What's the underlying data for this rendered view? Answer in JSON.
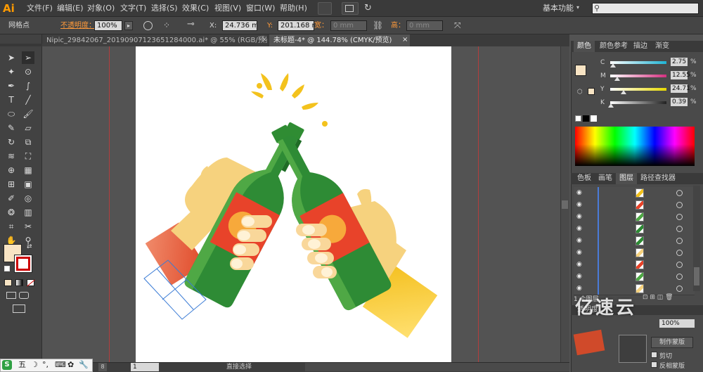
{
  "app": {
    "logo": "Ai",
    "menus": [
      "文件(F)",
      "编辑(E)",
      "对象(O)",
      "文字(T)",
      "选择(S)",
      "效果(C)",
      "视图(V)",
      "窗口(W)",
      "帮助(H)"
    ],
    "workspace": "基本功能"
  },
  "control": {
    "selection_label": "网格点",
    "opacity_label": "不透明度：",
    "opacity_value": "100%",
    "x_label": "X:",
    "x_value": "24.736 m",
    "y_label": "Y:",
    "y_value": "201.168 m",
    "w_label": "宽：",
    "w_value": "0 mm",
    "h_label": "高：",
    "h_value": "0 mm"
  },
  "tabs": [
    {
      "label": "Nipic_29842067_20190907123651284000.ai* @ 55% (RGB/预览)",
      "active": false
    },
    {
      "label": "未标题-4* @ 144.78% (CMYK/预览)",
      "active": true
    }
  ],
  "color_panel": {
    "tabs": [
      "颜色",
      "颜色参考",
      "描边",
      "渐变"
    ],
    "channels": [
      {
        "name": "C",
        "value": "2.75",
        "pct": 0.0275,
        "color": "#1fb3d3"
      },
      {
        "name": "M",
        "value": "12.55",
        "pct": 0.1255,
        "color": "#d4307f"
      },
      {
        "name": "Y",
        "value": "24.71",
        "pct": 0.2471,
        "color": "#e6d800"
      },
      {
        "name": "K",
        "value": "0.39",
        "pct": 0.0039,
        "color": "#222222"
      }
    ],
    "unit": "%",
    "fill_color": "#f8e4c4"
  },
  "layers_panel": {
    "tabs": [
      "色板",
      "画笔",
      "图层",
      "路径查找器"
    ],
    "row_count": 9,
    "footer": "1 个图层"
  },
  "lower_panel": {
    "tab": "透明度",
    "opacity": "100%",
    "make_mask": "制作蒙版",
    "clip": "剪切",
    "invert": "反相蒙版"
  },
  "status": {
    "page": "1",
    "tool": "直接选择",
    "zoom": "8"
  },
  "ime": {
    "items": [
      "五",
      "☽",
      "°,",
      "⌨",
      "✿",
      "🔧"
    ]
  },
  "watermark": {
    "text": "亿速云"
  }
}
